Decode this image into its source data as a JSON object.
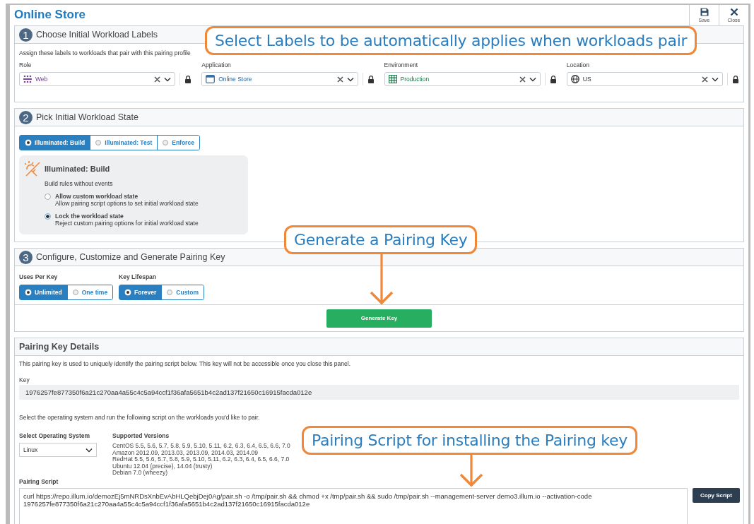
{
  "app_title": "Online Store",
  "toolbar": [
    {
      "kind": "save",
      "label": "Save"
    },
    {
      "kind": "close",
      "label": "Close"
    }
  ],
  "labels_section": {
    "number": "1",
    "title": "Choose Initial Workload Labels",
    "description": "Assign these labels to workloads that pair with this pairing profile",
    "fields": [
      {
        "kind": "role",
        "label": "Role",
        "value": "Web"
      },
      {
        "kind": "application",
        "label": "Application",
        "value": "Online Store"
      },
      {
        "kind": "environment",
        "label": "Environment",
        "value": "Production"
      },
      {
        "kind": "location",
        "label": "Location",
        "value": "US"
      }
    ]
  },
  "state_section": {
    "number": "2",
    "title": "Pick Initial Workload State",
    "modes": [
      {
        "label": "Illuminated: Build",
        "selected": true
      },
      {
        "label": "Illuminated: Test",
        "selected": false
      },
      {
        "label": "Enforce",
        "selected": false
      }
    ],
    "detail": {
      "title": "Illuminated: Build",
      "description": "Build rules without events",
      "options": [
        {
          "title": "Allow custom workload state",
          "description": "Allow pairing script options to set initial workload state",
          "selected": false
        },
        {
          "title": "Lock the workload state",
          "description": "Reject custom pairing options for initial workload state",
          "selected": true
        }
      ]
    }
  },
  "key_section": {
    "number": "3",
    "title": "Configure, Customize and Generate Pairing Key",
    "groups": [
      {
        "label": "Uses Per Key",
        "options": [
          {
            "label": "Unlimited",
            "selected": true
          },
          {
            "label": "One time",
            "selected": false
          }
        ]
      },
      {
        "label": "Key Lifespan",
        "options": [
          {
            "label": "Forever",
            "selected": true
          },
          {
            "label": "Custom",
            "selected": false
          }
        ]
      }
    ],
    "generate_button": "Generate Key"
  },
  "details": {
    "title": "Pairing Key Details",
    "description": "This pairing key is used to uniquely identify the pairing script below. This key will not be accessible once you close this panel.",
    "key_label": "Key",
    "key": "1976257fe877350f6a21c270aa4a55c4c5a94ccf1f36afa5651b4c2ad137f21650c16915facda012e",
    "instruction": "Select the operating system and run the following script on the workloads you'd like to pair.",
    "os_label": "Select Operating System",
    "os_value": "Linux",
    "versions_label": "Supported Versions",
    "versions": [
      "CentOS 5.5, 5.6, 5.7, 5.8, 5.9, 5.10, 5.11, 6.2, 6.3, 6.4, 6.5, 6.6, 7.0",
      "Amazon 2012.09, 2013.03, 2013.09, 2014.03, 2014.09",
      "RedHat 5.5, 5.6, 5.7, 5.8, 5.9, 5.10, 5.11, 6.2, 6.3, 6.4, 6.5, 6.6, 7.0",
      "Ubuntu 12.04 (precise), 14.04 (trusty)",
      "Debian 7.0 (wheezy)"
    ],
    "script_label": "Pairing Script",
    "script_lines": [
      "curl https://repo.illum.io/demozEj5mNRDsXnbEvAbHLQebjDej0Ag/pair.sh -o /tmp/pair.sh && chmod +x /tmp/pair.sh && sudo /tmp/pair.sh --management-server demo3.illum.io --activation-code",
      "1976257fe877350f6a21c270aa4a55c4c5a94ccf1f36afa5651b4c2ad137f21650c16915facda012e"
    ],
    "copy_button": "Copy Script"
  },
  "callouts": [
    {
      "text": "Select Labels to be automatically applies when workloads pair",
      "arrow": false
    },
    {
      "text": "Generate a Pairing Key",
      "arrow": true
    },
    {
      "text": "Pairing Script for installing the Pairing key",
      "arrow": true
    }
  ]
}
